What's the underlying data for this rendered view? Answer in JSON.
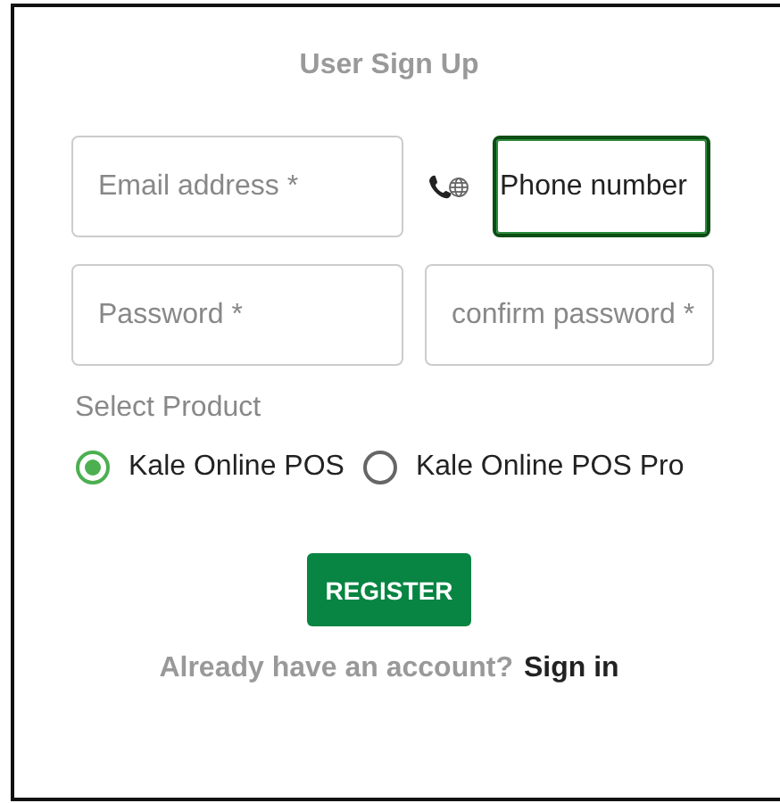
{
  "title": "User Sign Up",
  "fields": [
    {
      "placeholder": "Email address *",
      "focused": false
    },
    {
      "placeholder": "Phone number",
      "focused": true
    },
    {
      "placeholder": "Password *",
      "focused": false
    },
    {
      "placeholder": "confirm password *",
      "focused": false
    }
  ],
  "product": {
    "label": "Select Product",
    "options": [
      {
        "label": "Kale Online POS",
        "selected": true
      },
      {
        "label": "Kale Online POS Pro",
        "selected": false
      }
    ]
  },
  "register_button": "REGISTER",
  "signin": {
    "prompt": "Already have an account?",
    "link": "Sign in"
  }
}
